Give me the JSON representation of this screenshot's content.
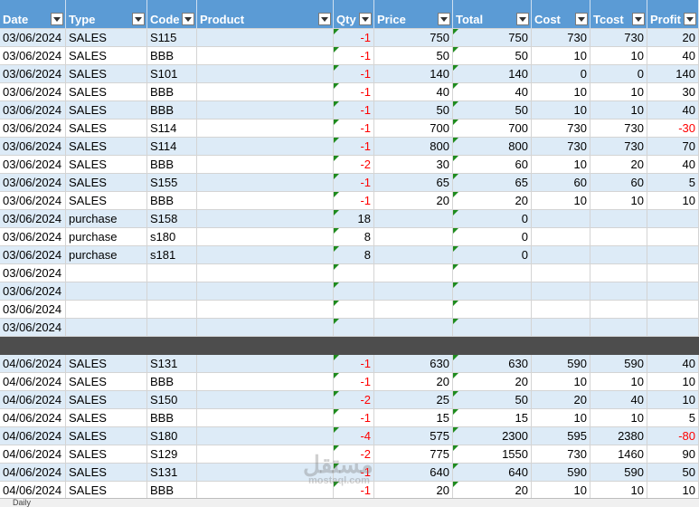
{
  "headers": [
    "Date",
    "Type",
    "Code",
    "Product",
    "Qty",
    "Price",
    "Total",
    "Cost",
    "Tcost",
    "Profit"
  ],
  "rows": [
    {
      "style": "band",
      "cells": [
        "03/06/2024",
        "SALES",
        "S115",
        "",
        "-1",
        "750",
        "750",
        "730",
        "730",
        "20"
      ],
      "neg": [
        4
      ]
    },
    {
      "style": "plain",
      "cells": [
        "03/06/2024",
        "SALES",
        "BBB",
        "",
        "-1",
        "50",
        "50",
        "10",
        "10",
        "40"
      ],
      "neg": [
        4
      ]
    },
    {
      "style": "band",
      "cells": [
        "03/06/2024",
        "SALES",
        "S101",
        "",
        "-1",
        "140",
        "140",
        "0",
        "0",
        "140"
      ],
      "neg": [
        4
      ]
    },
    {
      "style": "plain",
      "cells": [
        "03/06/2024",
        "SALES",
        "BBB",
        "",
        "-1",
        "40",
        "40",
        "10",
        "10",
        "30"
      ],
      "neg": [
        4
      ]
    },
    {
      "style": "band",
      "cells": [
        "03/06/2024",
        "SALES",
        "BBB",
        "",
        "-1",
        "50",
        "50",
        "10",
        "10",
        "40"
      ],
      "neg": [
        4
      ]
    },
    {
      "style": "plain",
      "cells": [
        "03/06/2024",
        "SALES",
        "S114",
        "",
        "-1",
        "700",
        "700",
        "730",
        "730",
        "-30"
      ],
      "neg": [
        4,
        9
      ]
    },
    {
      "style": "band",
      "cells": [
        "03/06/2024",
        "SALES",
        "S114",
        "",
        "-1",
        "800",
        "800",
        "730",
        "730",
        "70"
      ],
      "neg": [
        4
      ]
    },
    {
      "style": "plain",
      "cells": [
        "03/06/2024",
        "SALES",
        "BBB",
        "",
        "-2",
        "30",
        "60",
        "10",
        "20",
        "40"
      ],
      "neg": [
        4
      ]
    },
    {
      "style": "band",
      "cells": [
        "03/06/2024",
        "SALES",
        "S155",
        "",
        "-1",
        "65",
        "65",
        "60",
        "60",
        "5"
      ],
      "neg": [
        4
      ]
    },
    {
      "style": "plain",
      "cells": [
        "03/06/2024",
        "SALES",
        "BBB",
        "",
        "-1",
        "20",
        "20",
        "10",
        "10",
        "10"
      ],
      "neg": [
        4
      ]
    },
    {
      "style": "band",
      "cells": [
        "03/06/2024",
        "purchase",
        "S158",
        "",
        "18",
        "",
        "0",
        "",
        "",
        ""
      ],
      "neg": []
    },
    {
      "style": "plain",
      "cells": [
        "03/06/2024",
        "purchase",
        "s180",
        "",
        "8",
        "",
        "0",
        "",
        "",
        ""
      ],
      "neg": []
    },
    {
      "style": "band",
      "cells": [
        "03/06/2024",
        "purchase",
        "s181",
        "",
        "8",
        "",
        "0",
        "",
        "",
        ""
      ],
      "neg": []
    },
    {
      "style": "plain",
      "cells": [
        "03/06/2024",
        "",
        "",
        "",
        "",
        "",
        "",
        "",
        "",
        ""
      ],
      "neg": []
    },
    {
      "style": "band",
      "cells": [
        "03/06/2024",
        "",
        "",
        "",
        "",
        "",
        "",
        "",
        "",
        ""
      ],
      "neg": []
    },
    {
      "style": "plain",
      "cells": [
        "03/06/2024",
        "",
        "",
        "",
        "",
        "",
        "",
        "",
        "",
        ""
      ],
      "neg": []
    },
    {
      "style": "band",
      "cells": [
        "03/06/2024",
        "",
        "",
        "",
        "",
        "",
        "",
        "",
        "",
        ""
      ],
      "neg": []
    },
    {
      "style": "dark",
      "cells": [
        "",
        "",
        "",
        "",
        "",
        "",
        "",
        "",
        "",
        ""
      ],
      "neg": []
    },
    {
      "style": "band",
      "cells": [
        "04/06/2024",
        "SALES",
        "S131",
        "",
        "-1",
        "630",
        "630",
        "590",
        "590",
        "40"
      ],
      "neg": [
        4
      ]
    },
    {
      "style": "plain",
      "cells": [
        "04/06/2024",
        "SALES",
        "BBB",
        "",
        "-1",
        "20",
        "20",
        "10",
        "10",
        "10"
      ],
      "neg": [
        4
      ]
    },
    {
      "style": "band",
      "cells": [
        "04/06/2024",
        "SALES",
        "S150",
        "",
        "-2",
        "25",
        "50",
        "20",
        "40",
        "10"
      ],
      "neg": [
        4
      ]
    },
    {
      "style": "plain",
      "cells": [
        "04/06/2024",
        "SALES",
        "BBB",
        "",
        "-1",
        "15",
        "15",
        "10",
        "10",
        "5"
      ],
      "neg": [
        4
      ]
    },
    {
      "style": "band",
      "cells": [
        "04/06/2024",
        "SALES",
        "S180",
        "",
        "-4",
        "575",
        "2300",
        "595",
        "2380",
        "-80"
      ],
      "neg": [
        4,
        9
      ]
    },
    {
      "style": "plain",
      "cells": [
        "04/06/2024",
        "SALES",
        "S129",
        "",
        "-2",
        "775",
        "1550",
        "730",
        "1460",
        "90"
      ],
      "neg": [
        4
      ]
    },
    {
      "style": "band",
      "cells": [
        "04/06/2024",
        "SALES",
        "S131",
        "",
        "-1",
        "640",
        "640",
        "590",
        "590",
        "50"
      ],
      "neg": [
        4
      ]
    },
    {
      "style": "plain",
      "cells": [
        "04/06/2024",
        "SALES",
        "BBB",
        "",
        "-1",
        "20",
        "20",
        "10",
        "10",
        "10"
      ],
      "neg": [
        4
      ]
    }
  ],
  "sheet_tabs": [
    "Daily"
  ],
  "watermark": {
    "main": "مستقل",
    "sub": "mostaql.com"
  }
}
